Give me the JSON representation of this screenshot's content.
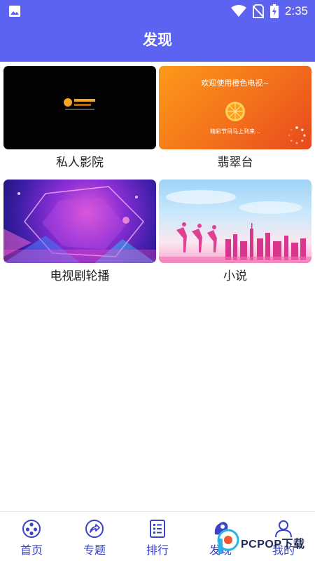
{
  "status_bar": {
    "time": "2:35"
  },
  "header": {
    "title": "发现"
  },
  "cards": [
    {
      "label": "私人影院"
    },
    {
      "label": "翡翠台",
      "thumb_welcome": "欢迎使用橙色电视~",
      "thumb_subtitle": "精彩节目马上到来..."
    },
    {
      "label": "电视剧轮播"
    },
    {
      "label": "小说"
    }
  ],
  "nav": {
    "items": [
      {
        "label": "首页",
        "icon": "film-reel-icon"
      },
      {
        "label": "专题",
        "icon": "share-arrow-icon"
      },
      {
        "label": "排行",
        "icon": "list-rank-icon"
      },
      {
        "label": "发现",
        "icon": "discover-icon"
      },
      {
        "label": "我的",
        "icon": "user-icon"
      }
    ]
  },
  "watermark": {
    "text": "PCPOP下载"
  },
  "colors": {
    "primary": "#5b63f0",
    "nav_text": "#3b44c6"
  }
}
